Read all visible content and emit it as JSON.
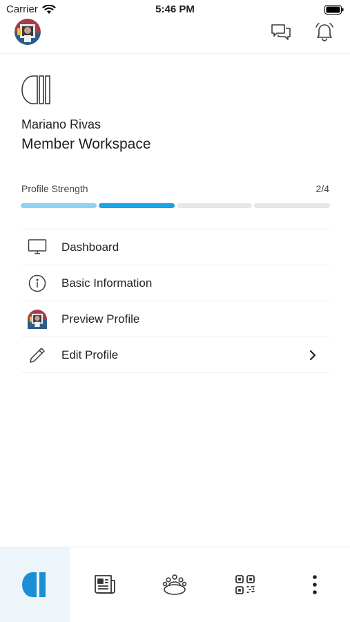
{
  "status_bar": {
    "carrier": "Carrier",
    "time": "5:46 PM"
  },
  "header": {
    "avatar": "user-avatar",
    "icons": [
      "chat-icon",
      "bell-icon"
    ]
  },
  "profile": {
    "name": "Mariano Rivas",
    "workspace": "Member Workspace",
    "strength_label": "Profile Strength",
    "strength_count": "2/4",
    "strength_filled": 2,
    "strength_total": 4,
    "strength_colors": [
      "#8fd3f4",
      "#1aa3e6"
    ]
  },
  "menu": {
    "items": [
      {
        "label": "Dashboard",
        "icon": "monitor-icon"
      },
      {
        "label": "Basic Information",
        "icon": "info-icon"
      },
      {
        "label": "Preview Profile",
        "icon": "avatar-icon"
      },
      {
        "label": "Edit Profile",
        "icon": "pencil-icon",
        "chevron": true
      }
    ]
  },
  "bottom_nav": {
    "tabs": [
      "home-logo-icon",
      "newspaper-icon",
      "community-icon",
      "qr-code-icon",
      "more-icon"
    ],
    "active": 0,
    "accent": "#1a8fd6"
  }
}
